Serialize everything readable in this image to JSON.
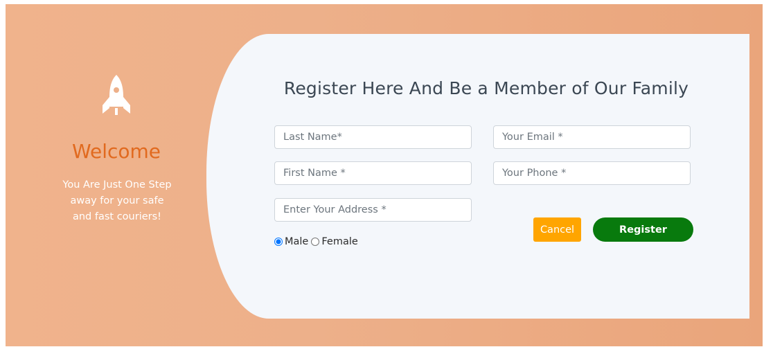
{
  "welcome": {
    "icon": "rocket-icon",
    "heading": "Welcome",
    "tagline": "You Are Just One Step away for your safe and fast couriers!"
  },
  "form": {
    "title": "Register Here And Be a Member of Our Family",
    "last_name": {
      "placeholder": "Last Name*",
      "value": ""
    },
    "first_name": {
      "placeholder": "First Name *",
      "value": ""
    },
    "address": {
      "placeholder": "Enter Your Address *",
      "value": ""
    },
    "email": {
      "placeholder": "Your Email *",
      "value": ""
    },
    "phone": {
      "placeholder": "Your Phone *",
      "value": ""
    },
    "gender": {
      "options": [
        "Male",
        "Female"
      ],
      "selected": "Male"
    },
    "cancel_label": "Cancel",
    "register_label": "Register"
  },
  "colors": {
    "background_gradient": [
      "#f0b38c",
      "#eaa57b"
    ],
    "welcome_text": "#e16a1f",
    "card_bg": "#f4f7fb",
    "cancel_button": "#ffa500",
    "register_button": "#087a0d"
  }
}
